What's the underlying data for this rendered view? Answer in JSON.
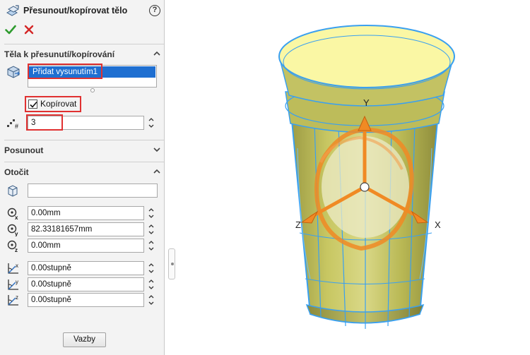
{
  "panel": {
    "title": "Přesunout/kopírovat tělo",
    "help_glyph": "?",
    "ok_icon": "checkmark-icon",
    "cancel_icon": "x-icon"
  },
  "bodies_section": {
    "title": "Těla k přesunutí/kopírování",
    "selected_body": "Přidat vysunutím1",
    "copy_checkbox": {
      "label": "Kopírovat",
      "checked": true
    },
    "copy_count": "3"
  },
  "translate_section": {
    "title": "Posunout",
    "expanded": false
  },
  "rotate_section": {
    "title": "Otočit",
    "expanded": true,
    "reference_value": "",
    "x_origin": "0.00mm",
    "y_origin": "82.33181657mm",
    "z_origin": "0.00mm",
    "x_angle": "0.00stupně",
    "y_angle": "0.00stupně",
    "z_angle": "0.00stupně"
  },
  "constraints_button": "Vazby",
  "triad": {
    "x": "X",
    "y": "Y",
    "z": "Z"
  },
  "colors": {
    "highlight_red": "#e03131",
    "selection_blue": "#1f6fd1",
    "triad_orange": "#f08a24",
    "model_edge_blue": "#3aa0f0",
    "model_face": "#c9c85c"
  }
}
